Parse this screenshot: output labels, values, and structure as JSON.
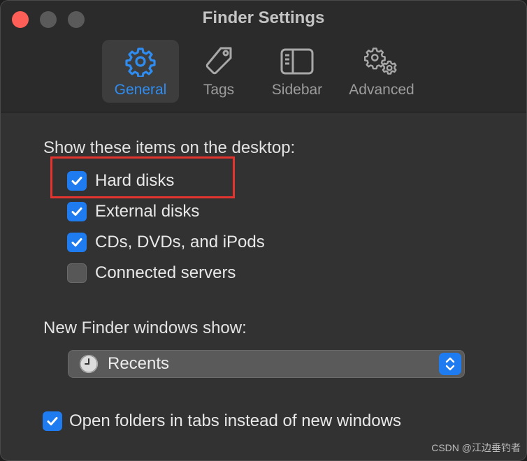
{
  "window": {
    "title": "Finder Settings"
  },
  "tabs": [
    {
      "label": "General",
      "icon": "gear-icon",
      "active": true
    },
    {
      "label": "Tags",
      "icon": "tag-icon",
      "active": false
    },
    {
      "label": "Sidebar",
      "icon": "sidebar-icon",
      "active": false
    },
    {
      "label": "Advanced",
      "icon": "gears-icon",
      "active": false
    }
  ],
  "desktop": {
    "label": "Show these items on the desktop:",
    "items": [
      {
        "label": "Hard disks",
        "checked": true
      },
      {
        "label": "External disks",
        "checked": true
      },
      {
        "label": "CDs, DVDs, and iPods",
        "checked": true
      },
      {
        "label": "Connected servers",
        "checked": false
      }
    ]
  },
  "new_windows": {
    "label": "New Finder windows show:",
    "value": "Recents",
    "icon": "clock-icon"
  },
  "open_in_tabs": {
    "label": "Open folders in tabs instead of new windows",
    "checked": true
  },
  "watermark": "CSDN @江边垂钓者",
  "colors": {
    "accent": "#1f7cf0",
    "highlight": "#e3342f",
    "close": "#ff5f57"
  }
}
